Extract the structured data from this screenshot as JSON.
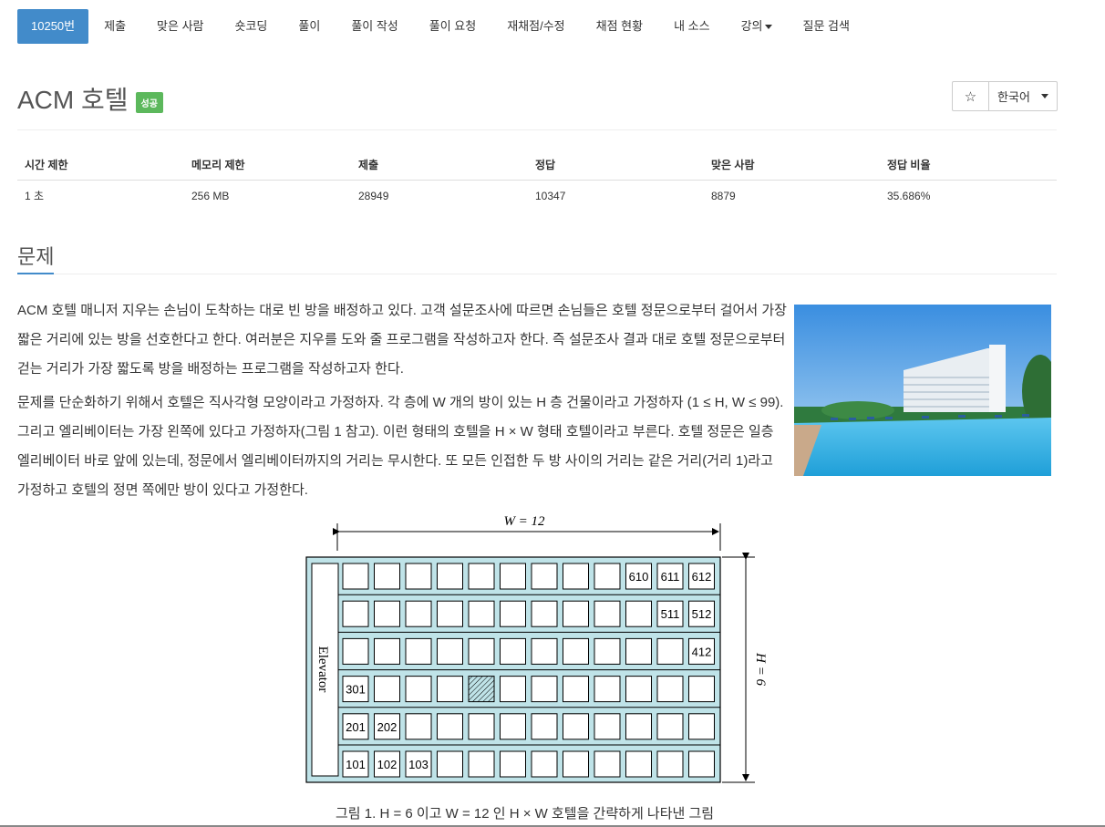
{
  "nav": {
    "items": [
      {
        "label": "10250번",
        "active": true
      },
      {
        "label": "제출"
      },
      {
        "label": "맞은 사람"
      },
      {
        "label": "숏코딩"
      },
      {
        "label": "풀이"
      },
      {
        "label": "풀이 작성"
      },
      {
        "label": "풀이 요청"
      },
      {
        "label": "재채점/수정"
      },
      {
        "label": "채점 현황"
      },
      {
        "label": "내 소스"
      },
      {
        "label": "강의",
        "dropdown": true
      },
      {
        "label": "질문 검색"
      }
    ]
  },
  "problem": {
    "title": "ACM 호텔",
    "badge": "성공",
    "star": "☆",
    "language": "한국어"
  },
  "info_table": {
    "headers": [
      "시간 제한",
      "메모리 제한",
      "제출",
      "정답",
      "맞은 사람",
      "정답 비율"
    ],
    "values": [
      "1 초",
      "256 MB",
      "28949",
      "10347",
      "8879",
      "35.686%"
    ]
  },
  "section": {
    "title": "문제",
    "paragraph1": "ACM 호텔 매니저 지우는 손님이 도착하는 대로 빈 방을 배정하고 있다. 고객 설문조사에 따르면 손님들은 호텔 정문으로부터 걸어서 가장 짧은 거리에 있는 방을 선호한다고 한다. 여러분은 지우를 도와 줄 프로그램을 작성하고자 한다. 즉 설문조사 결과 대로 호텔 정문으로부터 걷는 거리가 가장 짧도록 방을 배정하는 프로그램을 작성하고자 한다.",
    "paragraph2": "문제를 단순화하기 위해서 호텔은 직사각형 모양이라고 가정하자. 각 층에 W 개의 방이 있는 H 층 건물이라고 가정하자 (1 ≤ H, W ≤ 99). 그리고 엘리베이터는 가장 왼쪽에 있다고 가정하자(그림 1 참고). 이런 형태의 호텔을 H × W 형태 호텔이라고 부른다. 호텔 정문은 일층 엘리베이터 바로 앞에 있는데, 정문에서 엘리베이터까지의 거리는 무시한다. 또 모든 인접한 두 방 사이의 거리는 같은 거리(거리 1)라고 가정하고 호텔의 정면 쪽에만 방이 있다고 가정한다."
  },
  "figure": {
    "w_label": "W = 12",
    "h_label": "H = 6",
    "elevator_label": "Elevator",
    "rooms": {
      "6": {
        "10": "610",
        "11": "611",
        "12": "612"
      },
      "5": {
        "11": "511",
        "12": "512"
      },
      "4": {
        "12": "412"
      },
      "3": {
        "1": "301"
      },
      "2": {
        "1": "201",
        "2": "202"
      },
      "1": {
        "1": "101",
        "2": "102",
        "3": "103"
      }
    },
    "hatched_room": {
      "floor": 3,
      "col": 5
    },
    "colors": {
      "building": "#bfe3e8",
      "room": "#ffffff"
    },
    "caption": "그림 1. H = 6 이고 W = 12 인 H × W 호텔을 간략하게 나타낸 그림"
  }
}
